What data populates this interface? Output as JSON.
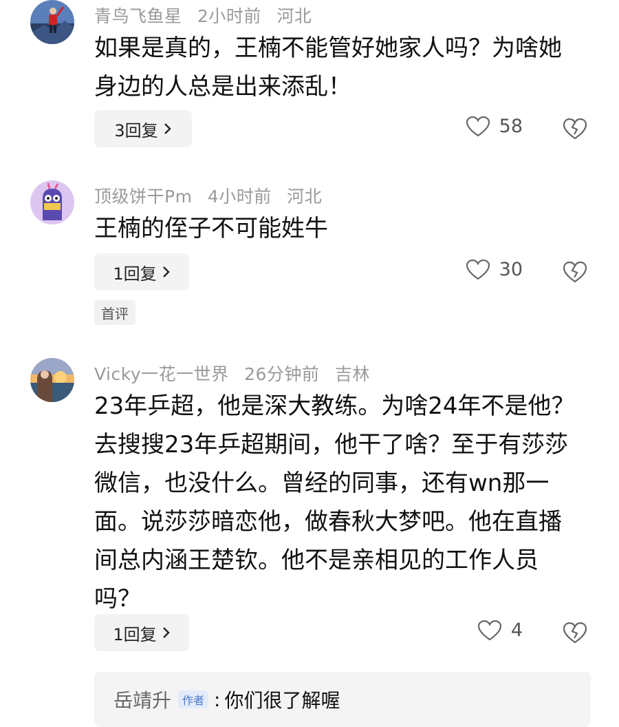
{
  "comments": [
    {
      "username": "青鸟飞鱼星",
      "time": "2小时前",
      "location": "河北",
      "text": "如果是真的，王楠不能管好她家人吗？为啥她\n身边的人总是出来添乱！",
      "reply_label": "3回复",
      "likes": "58"
    },
    {
      "username": "顶级饼干Pm",
      "time": "4小时前",
      "location": "河北",
      "text": "王楠的侄子不可能姓牛",
      "reply_label": "1回复",
      "likes": "30",
      "tag": "首评"
    },
    {
      "username": "Vicky一花一世界",
      "time": "26分钟前",
      "location": "吉林",
      "text": "23年乒超，他是深大教练。为啥24年不是他？\n去搜搜23年乒超期间，他干了啥？至于有莎莎\n微信，也没什么。曾经的同事，还有wn那一\n面。说莎莎暗恋他，做春秋大梦吧。他在直播\n间总内涵王楚钦。他不是亲相见的工作人员\n吗？",
      "reply_label": "1回复",
      "likes": "4",
      "author_reply": {
        "name": "岳靖升",
        "badge": "作者",
        "colon": ":",
        "text": "你们很了解喔"
      }
    }
  ],
  "icons": {
    "reply_chevron": "chevron-right-icon",
    "like": "heart-icon",
    "dislike": "broken-heart-icon"
  }
}
